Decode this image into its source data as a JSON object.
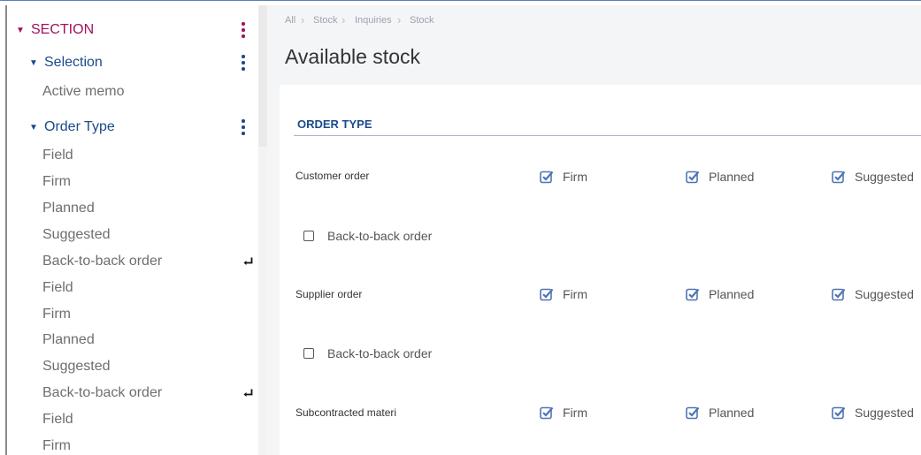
{
  "sidebar": {
    "section": {
      "label": "SECTION"
    },
    "groups": [
      {
        "label": "Selection"
      },
      {
        "label": "Order Type"
      }
    ],
    "items": [
      "Active memo",
      "Field",
      "Firm",
      "Planned",
      "Suggested",
      "Back-to-back order",
      "Field",
      "Firm",
      "Planned",
      "Suggested",
      "Back-to-back order",
      "Field",
      "Firm"
    ]
  },
  "breadcrumb": [
    "All",
    "Stock",
    "Inquiries",
    "Stock"
  ],
  "page": {
    "title": "Available stock"
  },
  "order_type": {
    "title": "ORDER TYPE",
    "rows": [
      {
        "label": "Customer order",
        "firm": "Firm",
        "planned": "Planned",
        "suggested": "Suggested",
        "back_to_back": "Back-to-back order",
        "firm_checked": true,
        "planned_checked": true,
        "suggested_checked": true,
        "back_to_back_checked": false
      },
      {
        "label": "Supplier order",
        "firm": "Firm",
        "planned": "Planned",
        "suggested": "Suggested",
        "back_to_back": "Back-to-back order",
        "firm_checked": true,
        "planned_checked": true,
        "suggested_checked": true,
        "back_to_back_checked": false
      },
      {
        "label": "Subcontracted materi",
        "firm": "Firm",
        "planned": "Planned",
        "suggested": "Suggested",
        "firm_checked": true,
        "planned_checked": true,
        "suggested_checked": true
      }
    ]
  },
  "colors": {
    "section": "#a1125c",
    "accent": "#1b4a8c",
    "checkbox": "#4f74b4"
  },
  "icons": {
    "caret": "caret-down-icon",
    "more": "kebab-icon",
    "enter": "enter-icon",
    "checked": "checkbox-checked-icon",
    "unchecked": "checkbox-empty-icon"
  }
}
